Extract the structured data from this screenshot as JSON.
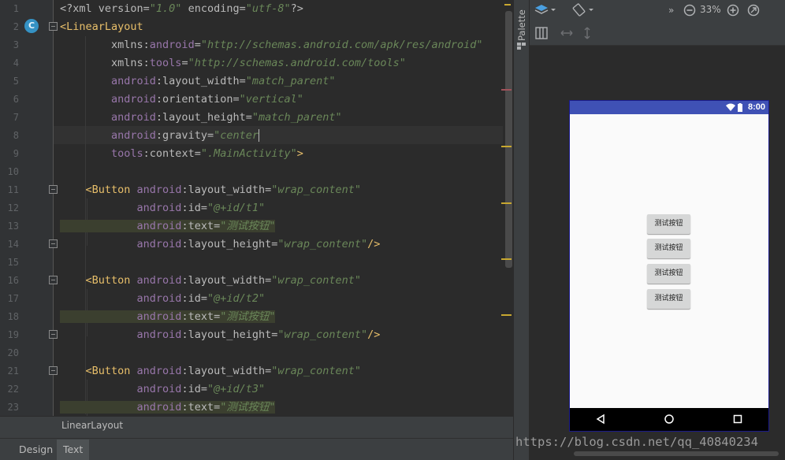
{
  "editor": {
    "line_numbers": [
      "1",
      "2",
      "3",
      "4",
      "5",
      "6",
      "7",
      "8",
      "9",
      "10",
      "11",
      "12",
      "13",
      "14",
      "15",
      "16",
      "17",
      "18",
      "19",
      "20",
      "21",
      "22",
      "23"
    ],
    "lines": [
      [
        {
          "c": "t-attr",
          "t": "<?xml version="
        },
        {
          "c": "t-val it",
          "t": "\"1.0\""
        },
        {
          "c": "t-attr",
          "t": " encoding="
        },
        {
          "c": "t-val it",
          "t": "\"utf-8\""
        },
        {
          "c": "t-attr",
          "t": "?>"
        }
      ],
      [
        {
          "c": "t-tag",
          "t": "<LinearLayout"
        }
      ],
      [
        {
          "c": "t-attr",
          "t": "        xmlns:"
        },
        {
          "c": "t-ns",
          "t": "android"
        },
        {
          "c": "t-attr",
          "t": "="
        },
        {
          "c": "t-val it",
          "t": "\"http://schemas.android.com/apk/res/android\""
        }
      ],
      [
        {
          "c": "t-attr",
          "t": "        xmlns:"
        },
        {
          "c": "t-ns",
          "t": "tools"
        },
        {
          "c": "t-attr",
          "t": "="
        },
        {
          "c": "t-val it",
          "t": "\"http://schemas.android.com/tools\""
        }
      ],
      [
        {
          "c": "t-ns",
          "t": "        android"
        },
        {
          "c": "t-attr",
          "t": ":layout_width="
        },
        {
          "c": "t-val it",
          "t": "\"match_parent\""
        }
      ],
      [
        {
          "c": "t-ns",
          "t": "        android"
        },
        {
          "c": "t-attr",
          "t": ":orientation="
        },
        {
          "c": "t-val it",
          "t": "\"vertical\""
        }
      ],
      [
        {
          "c": "t-ns",
          "t": "        android"
        },
        {
          "c": "t-attr",
          "t": ":layout_height="
        },
        {
          "c": "t-val it",
          "t": "\"match_parent\""
        }
      ],
      [
        {
          "c": "t-ns",
          "t": "        android"
        },
        {
          "c": "t-attr",
          "t": ":gravity="
        },
        {
          "c": "t-val it",
          "t": "\"center"
        },
        {
          "c": "caret",
          "t": ""
        }
      ],
      [
        {
          "c": "t-ns",
          "t": "        tools"
        },
        {
          "c": "t-attr",
          "t": ":context="
        },
        {
          "c": "t-val it",
          "t": "\".MainActivity\""
        },
        {
          "c": "t-tag",
          "t": ">"
        }
      ],
      [],
      [
        {
          "c": "t-tag",
          "t": "    <Button "
        },
        {
          "c": "t-ns",
          "t": "android"
        },
        {
          "c": "t-attr",
          "t": ":layout_width="
        },
        {
          "c": "t-val it",
          "t": "\"wrap_content\""
        }
      ],
      [
        {
          "c": "t-ns",
          "t": "            android"
        },
        {
          "c": "t-attr",
          "t": ":id="
        },
        {
          "c": "t-val it",
          "t": "\"@+id/t1\""
        }
      ],
      [
        {
          "c": "t-ns t-hl",
          "t": "            android"
        },
        {
          "c": "t-attr t-hl",
          "t": ":text="
        },
        {
          "c": "t-val it t-hl",
          "t": "\"测试按钮\""
        }
      ],
      [
        {
          "c": "t-ns",
          "t": "            android"
        },
        {
          "c": "t-attr",
          "t": ":layout_height="
        },
        {
          "c": "t-val it",
          "t": "\"wrap_content\""
        },
        {
          "c": "t-tag",
          "t": "/>"
        }
      ],
      [],
      [
        {
          "c": "t-tag",
          "t": "    <Button "
        },
        {
          "c": "t-ns",
          "t": "android"
        },
        {
          "c": "t-attr",
          "t": ":layout_width="
        },
        {
          "c": "t-val it",
          "t": "\"wrap_content\""
        }
      ],
      [
        {
          "c": "t-ns",
          "t": "            android"
        },
        {
          "c": "t-attr",
          "t": ":id="
        },
        {
          "c": "t-val it",
          "t": "\"@+id/t2\""
        }
      ],
      [
        {
          "c": "t-ns t-hl",
          "t": "            android"
        },
        {
          "c": "t-attr t-hl",
          "t": ":text="
        },
        {
          "c": "t-val it t-hl",
          "t": "\"测试按钮\""
        }
      ],
      [
        {
          "c": "t-ns",
          "t": "            android"
        },
        {
          "c": "t-attr",
          "t": ":layout_height="
        },
        {
          "c": "t-val it",
          "t": "\"wrap_content\""
        },
        {
          "c": "t-tag",
          "t": "/>"
        }
      ],
      [],
      [
        {
          "c": "t-tag",
          "t": "    <Button "
        },
        {
          "c": "t-ns",
          "t": "android"
        },
        {
          "c": "t-attr",
          "t": ":layout_width="
        },
        {
          "c": "t-val it",
          "t": "\"wrap_content\""
        }
      ],
      [
        {
          "c": "t-ns",
          "t": "            android"
        },
        {
          "c": "t-attr",
          "t": ":id="
        },
        {
          "c": "t-val it",
          "t": "\"@+id/t3\""
        }
      ],
      [
        {
          "c": "t-ns t-hl",
          "t": "            android"
        },
        {
          "c": "t-attr t-hl",
          "t": ":text="
        },
        {
          "c": "t-val it t-hl",
          "t": "\"测试按钮\""
        }
      ]
    ],
    "gutter_badge": "C"
  },
  "breadcrumb": {
    "text": "LinearLayout"
  },
  "tabs": {
    "design": "Design",
    "text": "Text"
  },
  "palette": {
    "label": "Palette"
  },
  "toolbar": {
    "zoom": "33%",
    "more": "»"
  },
  "device": {
    "time": "8:00",
    "buttons": [
      "测试按钮",
      "测试按钮",
      "测试按钮",
      "测试按钮"
    ]
  },
  "watermark": "https://blog.csdn.net/qq_40840234",
  "colors": {
    "editor_bg": "#2b2b2b",
    "status_bar": "#3f51b5",
    "tag": "#e8bf6a",
    "namespace": "#9876aa",
    "value": "#6a8759"
  }
}
